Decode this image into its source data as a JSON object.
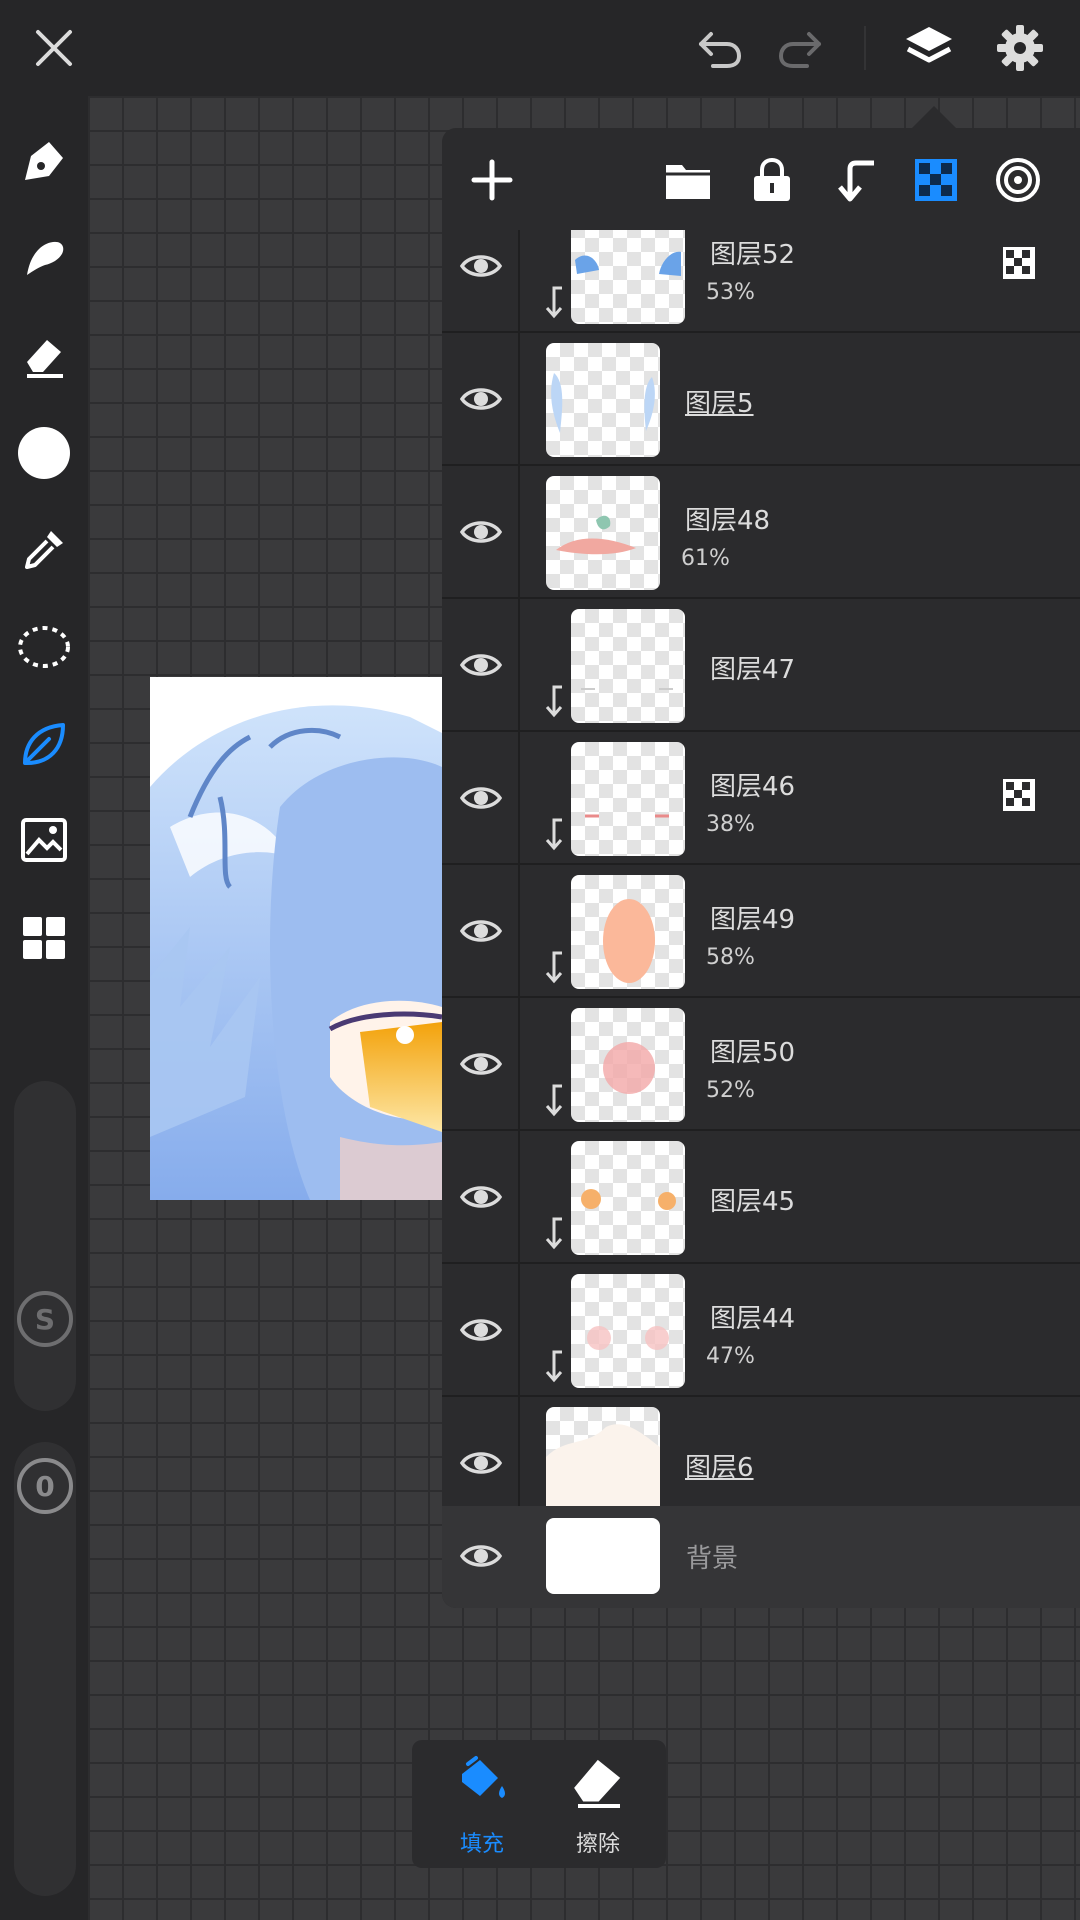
{
  "app": {
    "accent_color": "#1a8cff",
    "icon_color": "#dcdcdc"
  },
  "topbar": {
    "close_icon": "close-icon",
    "undo_icon": "undo-icon",
    "redo_icon": "redo-icon",
    "layers_icon": "layers-icon",
    "settings_icon": "gear-icon"
  },
  "left_toolbar": {
    "tools": [
      "pen-icon",
      "smudge-icon",
      "eraser-icon",
      "color-icon",
      "eyedropper-icon",
      "lasso-icon",
      "fill-leaf-icon",
      "image-import-icon",
      "grid-tiles-icon"
    ],
    "active_tool": "fill-leaf-icon",
    "size_slider_label": "S",
    "opacity_slider_label": "0"
  },
  "layer_panel": {
    "header_icons": [
      "add-layer-icon",
      "folder-icon",
      "lock-icon",
      "clip-icon",
      "alpha-lock-icon",
      "blend-icon"
    ],
    "layers": [
      {
        "name": "图层52",
        "opacity": "53%",
        "clipped": true,
        "alpha_locked": true,
        "underlined": false
      },
      {
        "name": "图层5",
        "opacity": "",
        "clipped": false,
        "alpha_locked": false,
        "underlined": true
      },
      {
        "name": "图层48",
        "opacity": "61%",
        "clipped": false,
        "alpha_locked": false,
        "underlined": false
      },
      {
        "name": "图层47",
        "opacity": "",
        "clipped": true,
        "alpha_locked": false,
        "underlined": false
      },
      {
        "name": "图层46",
        "opacity": "38%",
        "clipped": true,
        "alpha_locked": true,
        "underlined": false
      },
      {
        "name": "图层49",
        "opacity": "58%",
        "clipped": true,
        "alpha_locked": false,
        "underlined": false
      },
      {
        "name": "图层50",
        "opacity": "52%",
        "clipped": true,
        "alpha_locked": false,
        "underlined": false
      },
      {
        "name": "图层45",
        "opacity": "",
        "clipped": true,
        "alpha_locked": false,
        "underlined": false
      },
      {
        "name": "图层44",
        "opacity": "47%",
        "clipped": true,
        "alpha_locked": false,
        "underlined": false
      },
      {
        "name": "图层6",
        "opacity": "",
        "clipped": false,
        "alpha_locked": false,
        "underlined": true
      }
    ],
    "background_layer": {
      "name": "背景"
    }
  },
  "bottom_popup": {
    "fill_label": "填充",
    "erase_label": "擦除"
  }
}
